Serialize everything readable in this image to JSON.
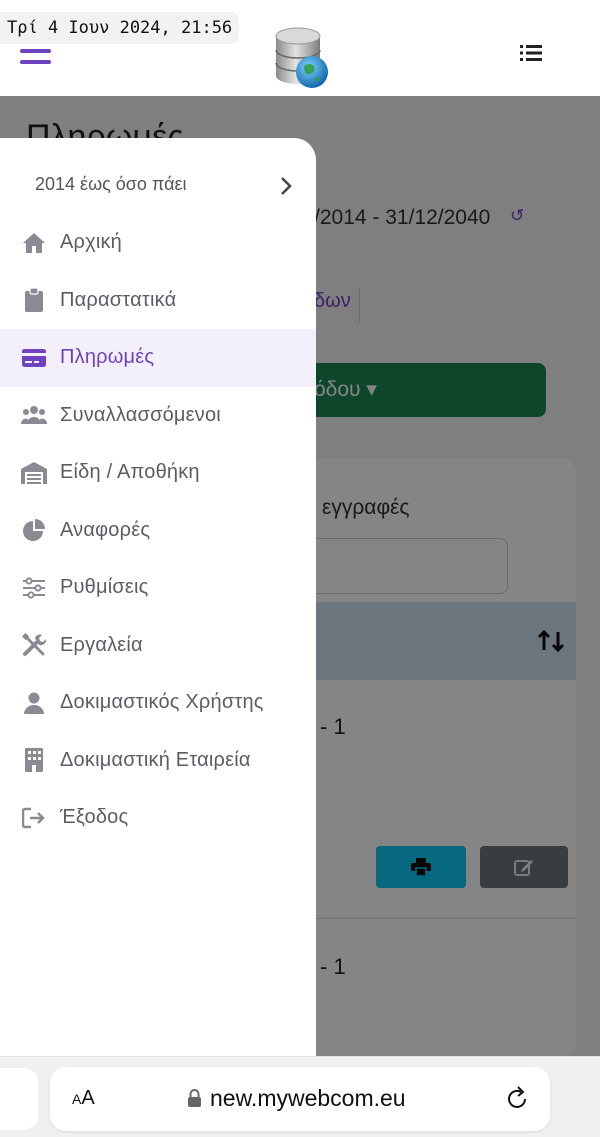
{
  "status": {
    "timestamp": "Τρί 4 Ιουν 2024, 21:56"
  },
  "colors": {
    "accent": "#6f42c1",
    "success": "#198754",
    "info": "#0dcaf0",
    "secondary": "#6c757d",
    "table_header": "#cfe2f3"
  },
  "header": {
    "menu_icon": "hamburger-icon",
    "logo": "database-globe-logo",
    "options_icon": "list-icon"
  },
  "page": {
    "title": "Πληρωμές",
    "date_range": "/2014 - 31/12/2040",
    "tab_fragment": "δων",
    "action_button": "όδου",
    "card": {
      "entries_text": "εγγραφές",
      "row1_text": "- 1",
      "row2_text": "- 1"
    }
  },
  "sidebar": {
    "period": "2014 έως όσο πάει",
    "items": [
      {
        "label": "Αρχική",
        "icon": "home-icon",
        "active": false
      },
      {
        "label": "Παραστατικά",
        "icon": "clipboard-icon",
        "active": false
      },
      {
        "label": "Πληρωμές",
        "icon": "credit-card-icon",
        "active": true
      },
      {
        "label": "Συναλλασσόμενοι",
        "icon": "users-icon",
        "active": false
      },
      {
        "label": "Είδη / Αποθήκη",
        "icon": "warehouse-icon",
        "active": false
      },
      {
        "label": "Αναφορές",
        "icon": "pie-chart-icon",
        "active": false
      },
      {
        "label": "Ρυθμίσεις",
        "icon": "sliders-icon",
        "active": false
      },
      {
        "label": "Εργαλεία",
        "icon": "tools-icon",
        "active": false
      },
      {
        "label": "Δοκιμαστικός Χρήστης",
        "icon": "user-icon",
        "active": false
      },
      {
        "label": "Δοκιμαστική Εταιρεία",
        "icon": "building-icon",
        "active": false
      },
      {
        "label": "Έξοδος",
        "icon": "logout-icon",
        "active": false
      }
    ]
  },
  "browser": {
    "text_size_label_small": "A",
    "text_size_label_big": "A",
    "url": "new.mywebcom.eu"
  }
}
